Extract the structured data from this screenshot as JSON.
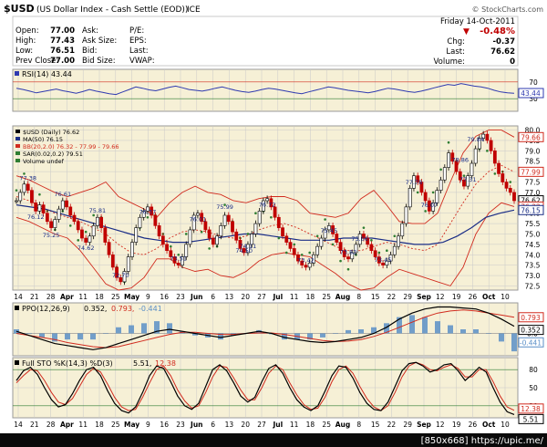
{
  "header": {
    "symbol": "$USD",
    "description": "(US Dollar Index - Cash Settle (EOD))",
    "exchange": "ICE",
    "watermark": "© StockCharts.com",
    "date": "Friday 14-Oct-2011",
    "change_pct": "-0.48%",
    "change_arrow": "▼"
  },
  "quote": {
    "open_label": "Open:",
    "open": "77.00",
    "high_label": "High:",
    "high": "77.43",
    "low_label": "Low:",
    "low": "76.51",
    "prev_label": "Prev Close:",
    "prev": "77.00",
    "ask_label": "Ask:",
    "ask": "",
    "asksize_label": "Ask Size:",
    "asksize": "",
    "bid_label": "Bid:",
    "bid": "",
    "bidsize_label": "Bid Size:",
    "bidsize": "",
    "pe_label": "P/E:",
    "pe": "",
    "eps_label": "EPS:",
    "eps": "",
    "last_label": "Last:",
    "last_blank": "",
    "vwap_label": "VWAP:",
    "vwap": "",
    "chg_label": "Chg:",
    "chg": "-0.37",
    "last2_label": "Last:",
    "last2": "76.62",
    "volume_label": "Volume:",
    "volume": "0"
  },
  "footer": "[850x668] https://upic.me/",
  "colors": {
    "panel_bg": "#f6f0d6",
    "grid": "#c9c9c9",
    "price": "#000000",
    "ma": "#1a2d86",
    "bb": "#d12b1e",
    "sar": "#2e7d32",
    "rsi": "#2f3ab0",
    "ppo": "#000000",
    "ppo_signal": "#d12b1e",
    "hist": "#5b8fc7",
    "sto_k": "#000000",
    "sto_d": "#d12b1e",
    "negative": "#c00000"
  },
  "chart_data": [
    {
      "type": "line",
      "title": "RSI(14) 43.44",
      "y_ticks": [
        "70",
        "30"
      ],
      "ref_levels": [
        70,
        30
      ],
      "ylim": [
        0,
        100
      ],
      "axis_label_top": "70",
      "axis_label_bottom": "30",
      "last_value_tag": "43.44",
      "series": [
        {
          "name": "RSI(14)",
          "values": [
            55,
            52,
            48,
            44,
            47,
            50,
            53,
            49,
            46,
            43,
            47,
            52,
            48,
            45,
            42,
            40,
            46,
            52,
            58,
            55,
            51,
            49,
            53,
            57,
            60,
            56,
            52,
            50,
            48,
            51,
            55,
            58,
            54,
            50,
            47,
            45,
            48,
            52,
            55,
            53,
            50,
            47,
            44,
            42,
            46,
            50,
            54,
            58,
            56,
            53,
            50,
            48,
            46,
            44,
            47,
            51,
            55,
            53,
            50,
            47,
            45,
            48,
            52,
            56,
            60,
            64,
            62,
            66,
            63,
            60,
            58,
            55,
            50,
            46,
            44,
            43
          ]
        }
      ]
    },
    {
      "type": "line",
      "title": "$USD (Daily) 76.62",
      "legend": [
        {
          "label": "$USD (Daily) 76.62",
          "color": "#000000"
        },
        {
          "label": "MA(50) 76.15",
          "color": "#1a2d86"
        },
        {
          "label": "BB(20,2.0) 76.32 - 77.99 - 79.66",
          "color": "#d12b1e"
        },
        {
          "label": "SAR(0.02,0.2) 79.51",
          "color": "#2e7d32"
        },
        {
          "label": "Volume undef",
          "color": "#2e7d32"
        }
      ],
      "ylim": [
        72.3,
        80.2
      ],
      "y_ticks": [
        "80.0",
        "79.5",
        "79.0",
        "78.5",
        "78.0",
        "77.5",
        "77.0",
        "76.5",
        "76.0",
        "75.5",
        "75.0",
        "74.5",
        "74.0",
        "73.5",
        "73.0",
        "72.5"
      ],
      "x_labels": [
        "14",
        "21",
        "28",
        "Apr",
        "11",
        "18",
        "25",
        "May",
        "9",
        "16",
        "23",
        "Jun",
        "6",
        "13",
        "20",
        "27",
        "Jul",
        "11",
        "18",
        "25",
        "Aug",
        "8",
        "15",
        "22",
        "29",
        "Sep",
        "12",
        "19",
        "26",
        "Oct",
        "10"
      ],
      "x_label_emphasis": [
        "Apr",
        "May",
        "Jun",
        "Jul",
        "Aug",
        "Sep",
        "Oct"
      ],
      "annotations": [
        "77.38",
        "76.12",
        "76.61",
        "75.25",
        "75.81",
        "74.62",
        "72.70",
        "76.37",
        "73.51",
        "76.01",
        "75.99",
        "74.50",
        "74.11",
        "76.72",
        "73.42",
        "75.45",
        "73.82",
        "75.06",
        "73.45",
        "77.78",
        "76.07",
        "78.86",
        "77.31",
        "79.84"
      ],
      "axis_tags": [
        {
          "label": "79.66",
          "color": "#d12b1e"
        },
        {
          "label": "77.99",
          "color": "#d12b1e"
        },
        {
          "label": "76.62",
          "color": "#000000"
        },
        {
          "label": "76.32",
          "color": "#d12b1e"
        },
        {
          "label": "76.15",
          "color": "#1a2d86"
        }
      ],
      "series": [
        {
          "name": "$USD (Daily) 76.62",
          "values": [
            76.6,
            77.0,
            77.4,
            77.1,
            76.5,
            76.1,
            76.4,
            76.0,
            75.6,
            75.3,
            75.7,
            76.2,
            76.6,
            76.3,
            75.9,
            75.6,
            75.2,
            74.8,
            74.6,
            74.9,
            75.4,
            75.8,
            75.3,
            74.6,
            74.0,
            73.4,
            72.9,
            72.7,
            73.2,
            73.9,
            74.6,
            75.3,
            75.8,
            76.1,
            76.3,
            75.9,
            75.4,
            74.9,
            74.5,
            74.2,
            73.9,
            73.6,
            73.5,
            73.9,
            74.5,
            75.2,
            75.9,
            76.0,
            75.6,
            75.2,
            74.8,
            74.5,
            74.9,
            75.4,
            75.9,
            75.6,
            75.1,
            74.7,
            74.3,
            74.1,
            74.5,
            75.0,
            75.5,
            76.1,
            76.6,
            76.7,
            76.3,
            75.8,
            75.3,
            74.9,
            74.6,
            74.3,
            74.0,
            73.7,
            73.5,
            73.4,
            73.6,
            74.0,
            74.4,
            74.8,
            75.2,
            75.4,
            75.0,
            74.6,
            74.2,
            73.9,
            73.8,
            74.1,
            74.5,
            75.0,
            74.8,
            74.5,
            74.2,
            73.9,
            73.6,
            73.5,
            73.7,
            74.0,
            74.4,
            74.9,
            75.5,
            76.3,
            77.2,
            77.8,
            77.5,
            77.0,
            76.6,
            76.1,
            76.5,
            77.1,
            77.6,
            78.2,
            78.9,
            78.5,
            78.0,
            77.6,
            77.3,
            77.8,
            78.4,
            79.1,
            79.6,
            79.8,
            79.5,
            79.0,
            78.4,
            77.9,
            77.5,
            77.2,
            77.0,
            76.6
          ]
        },
        {
          "name": "MA(50) 76.15",
          "values": [
            76.4,
            76.3,
            76.2,
            76.0,
            75.8,
            75.6,
            75.4,
            75.2,
            75.0,
            74.8,
            74.7,
            74.6,
            74.6,
            74.7,
            74.8,
            74.9,
            75.0,
            75.0,
            74.9,
            74.8,
            74.7,
            74.7,
            74.7,
            74.8,
            74.8,
            74.8,
            74.7,
            74.6,
            74.5,
            74.5,
            74.6,
            74.9,
            75.3,
            75.8,
            76.0,
            76.15
          ]
        },
        {
          "name": "BB upper",
          "values": [
            77.8,
            77.6,
            77.3,
            77.0,
            76.8,
            77.0,
            77.2,
            77.5,
            76.8,
            76.5,
            76.2,
            75.8,
            76.5,
            77.0,
            77.3,
            77.0,
            76.9,
            76.6,
            76.5,
            76.7,
            76.8,
            76.8,
            76.6,
            76.0,
            75.9,
            75.8,
            76.0,
            76.7,
            77.1,
            76.4,
            75.6,
            75.5,
            75.5,
            76.0,
            77.5,
            78.9,
            79.7,
            80.0,
            80.0,
            79.66
          ]
        },
        {
          "name": "BB middle",
          "values": [
            76.8,
            76.6,
            76.3,
            76.0,
            75.8,
            75.6,
            75.3,
            75.0,
            74.5,
            74.1,
            74.0,
            74.3,
            74.8,
            75.1,
            75.2,
            75.1,
            74.9,
            74.8,
            74.9,
            75.2,
            75.4,
            75.5,
            75.3,
            75.0,
            74.7,
            74.4,
            74.2,
            74.2,
            74.4,
            74.6,
            74.5,
            74.3,
            74.2,
            74.5,
            75.5,
            76.5,
            77.4,
            78.0,
            78.3,
            77.99
          ]
        },
        {
          "name": "BB lower",
          "values": [
            75.8,
            75.6,
            75.3,
            75.0,
            74.8,
            74.2,
            73.4,
            72.6,
            72.3,
            72.4,
            72.9,
            73.8,
            73.8,
            73.4,
            73.2,
            73.3,
            73.0,
            72.9,
            73.2,
            73.7,
            74.0,
            74.1,
            74.0,
            73.9,
            73.5,
            73.1,
            72.6,
            72.3,
            72.4,
            72.9,
            73.3,
            73.1,
            72.9,
            72.7,
            72.5,
            73.4,
            75.0,
            76.0,
            76.5,
            76.32
          ]
        }
      ]
    },
    {
      "type": "line",
      "title": "PPO(12,26,9) 0.352, 0.793, -0.441",
      "title_parts": {
        "label": "PPO(12,26,9)",
        "v1": "0.352,",
        "v2": "0.793,",
        "v3": "-0.441"
      },
      "y_ticks": [
        "0.0"
      ],
      "axis_tags": [
        "0.793",
        "0.352",
        "-0.441"
      ],
      "series": [
        {
          "name": "PPO",
          "values": [
            0.1,
            -0.1,
            -0.3,
            -0.5,
            -0.6,
            -0.7,
            -0.8,
            -0.7,
            -0.5,
            -0.3,
            -0.1,
            0.1,
            0.2,
            0.1,
            0.0,
            -0.1,
            -0.2,
            -0.1,
            0.0,
            0.1,
            0.0,
            -0.2,
            -0.3,
            -0.4,
            -0.45,
            -0.4,
            -0.3,
            -0.2,
            0.0,
            0.3,
            0.7,
            1.0,
            1.2,
            1.3,
            1.3,
            1.25,
            1.2,
            1.0,
            0.7,
            0.352
          ]
        },
        {
          "name": "Signal",
          "values": [
            0.0,
            -0.1,
            -0.2,
            -0.3,
            -0.45,
            -0.55,
            -0.65,
            -0.7,
            -0.65,
            -0.5,
            -0.35,
            -0.2,
            -0.05,
            0.05,
            0.05,
            0.0,
            -0.05,
            -0.05,
            0.0,
            0.02,
            0.02,
            -0.05,
            -0.15,
            -0.25,
            -0.35,
            -0.4,
            -0.38,
            -0.3,
            -0.15,
            0.05,
            0.3,
            0.55,
            0.8,
            1.0,
            1.1,
            1.15,
            1.1,
            1.0,
            0.9,
            0.793
          ]
        }
      ]
    },
    {
      "type": "line",
      "title": "Full STO %K(14,3) %D(3) 5.51, 12.38",
      "title_parts": {
        "label": "Full STO %K(14,3) %D(3)",
        "v1": "5.51,",
        "v2": "12.38"
      },
      "y_ticks": [
        "80",
        "50",
        "20"
      ],
      "ref_levels": [
        80,
        20
      ],
      "ylim": [
        0,
        100
      ],
      "axis_tags": [
        "12.38",
        "5.51"
      ],
      "series": [
        {
          "name": "%K",
          "values": [
            62,
            78,
            84,
            72,
            50,
            30,
            18,
            22,
            40,
            62,
            80,
            84,
            70,
            45,
            24,
            12,
            8,
            18,
            42,
            70,
            86,
            82,
            60,
            36,
            20,
            14,
            24,
            52,
            80,
            88,
            78,
            58,
            36,
            26,
            34,
            60,
            82,
            88,
            74,
            50,
            30,
            18,
            12,
            20,
            44,
            70,
            86,
            84,
            66,
            42,
            24,
            14,
            12,
            26,
            52,
            78,
            90,
            92,
            86,
            76,
            80,
            88,
            90,
            78,
            62,
            72,
            84,
            76,
            50,
            26,
            10,
            5.51
          ]
        },
        {
          "name": "%D",
          "values": [
            58,
            70,
            80,
            78,
            62,
            42,
            26,
            22,
            32,
            52,
            72,
            82,
            76,
            56,
            34,
            18,
            12,
            14,
            34,
            58,
            80,
            86,
            70,
            46,
            28,
            16,
            20,
            42,
            68,
            86,
            84,
            66,
            46,
            30,
            30,
            50,
            74,
            86,
            80,
            58,
            38,
            22,
            14,
            16,
            34,
            60,
            80,
            86,
            74,
            52,
            32,
            18,
            12,
            20,
            42,
            68,
            86,
            92,
            88,
            80,
            78,
            84,
            88,
            82,
            68,
            68,
            80,
            80,
            60,
            36,
            18,
            12.38
          ]
        }
      ]
    }
  ]
}
